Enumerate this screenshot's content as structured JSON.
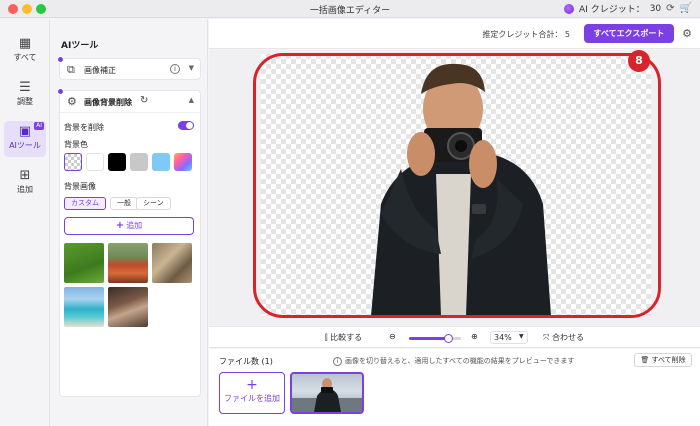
{
  "window": {
    "title": "一括画像エディター",
    "ai_credit_label": "AI クレジット：",
    "ai_credit_value": "30"
  },
  "rail": {
    "items": [
      {
        "label": "すべて",
        "icon": "grid-icon"
      },
      {
        "label": "調整",
        "icon": "sliders-icon"
      },
      {
        "label": "AIツール",
        "icon": "ai-tool-icon",
        "badge": "AI"
      },
      {
        "label": "追加",
        "icon": "plus-square-icon"
      }
    ]
  },
  "panel": {
    "title": "AIツール",
    "tool_enhance": "画像補正",
    "tool_bg_remove": "画像背景削除",
    "remove_bg_label": "背景を削除",
    "bg_color_label": "背景色",
    "bg_image_label": "背景画像",
    "bg_image_tabs": [
      "カスタム",
      "一般",
      "シーン"
    ],
    "add_label": "追加",
    "colors": [
      "transparent",
      "#ffffff",
      "#000000",
      "#c8c8c8",
      "#7fc9f6",
      "gradient"
    ]
  },
  "topbar": {
    "estimate_label": "推定クレジット合計：",
    "estimate_value": "5",
    "export_label": "すべてエクスポート"
  },
  "canvas": {
    "badge": "8"
  },
  "zoombar": {
    "compare_label": "比較する",
    "zoom_value": "34%",
    "zoom_level": 0.34,
    "fit_label": "合わせる"
  },
  "files": {
    "count_label": "ファイル数 (1)",
    "hint": "画像を切り替えると、適用したすべての機能の結果をプレビューできます",
    "delete_all_label": "すべて削除",
    "add_file_label": "ファイルを追加"
  },
  "accent_color": "#7b3fe4",
  "highlight_color": "#d9232a"
}
